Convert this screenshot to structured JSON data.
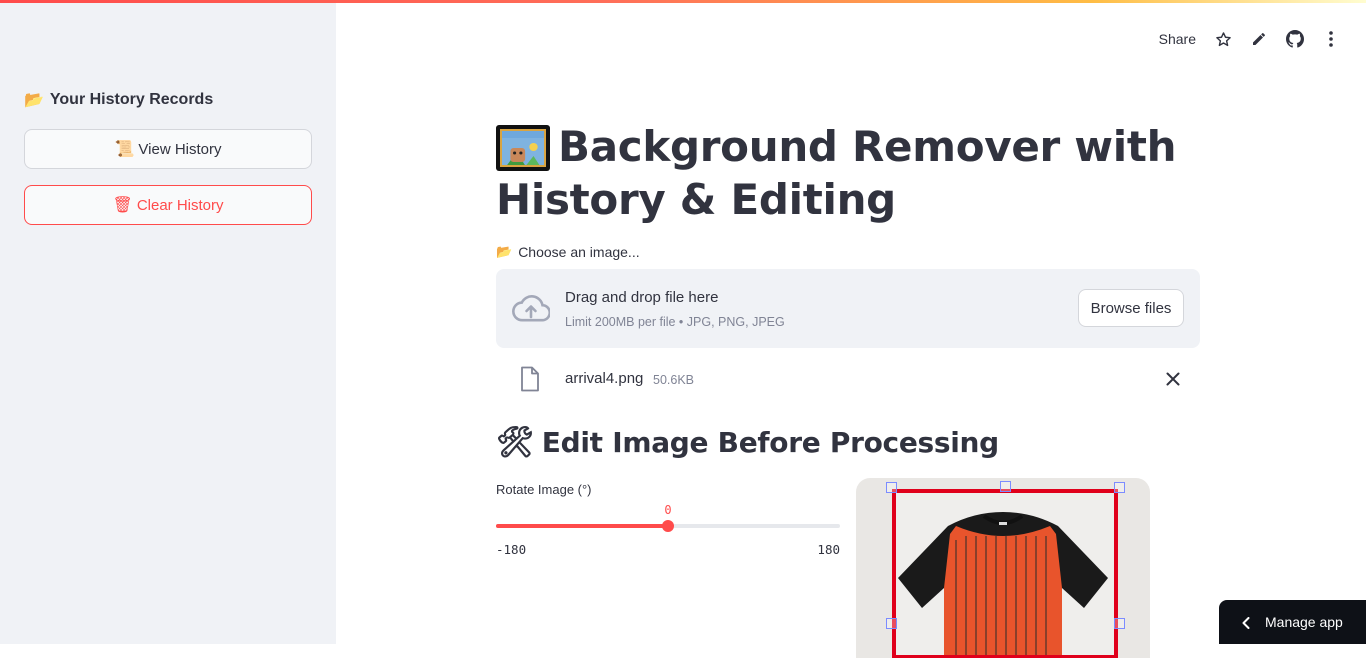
{
  "sidebar": {
    "header_icon": "folder-icon",
    "header_label": "Your History Records",
    "view_history": {
      "icon": "scroll-icon",
      "label": "View History"
    },
    "clear_history": {
      "icon": "wastebasket-icon",
      "label": "Clear History"
    }
  },
  "header": {
    "share_label": "Share",
    "icons": [
      "star-icon",
      "pencil-icon",
      "github-icon",
      "more-vertical-icon"
    ]
  },
  "main": {
    "title_icon": "framed-picture-icon",
    "title": "Background Remover with History & Editing",
    "uploader": {
      "label_icon": "folder-icon",
      "label": "Choose an image...",
      "drop_title": "Drag and drop file here",
      "drop_subtitle": "Limit 200MB per file • JPG, PNG, JPEG",
      "browse_label": "Browse files"
    },
    "file": {
      "name": "arrival4.png",
      "size": "50.6KB"
    },
    "edit_section": {
      "icon": "hammer-and-wrench-icon",
      "title": "Edit Image Before Processing"
    },
    "rotate": {
      "label": "Rotate Image (°)",
      "value": 0,
      "value_text": "0",
      "min": -180,
      "max": 180,
      "min_text": "-180",
      "max_text": "180"
    }
  },
  "manage_app": {
    "label": "Manage app"
  },
  "colors": {
    "accent": "#ff4b4b",
    "sidebar_bg": "#f0f2f6",
    "crop_border": "#e0001b",
    "shirt_body": "#e8542c",
    "shirt_sleeves": "#1a1a1a"
  }
}
